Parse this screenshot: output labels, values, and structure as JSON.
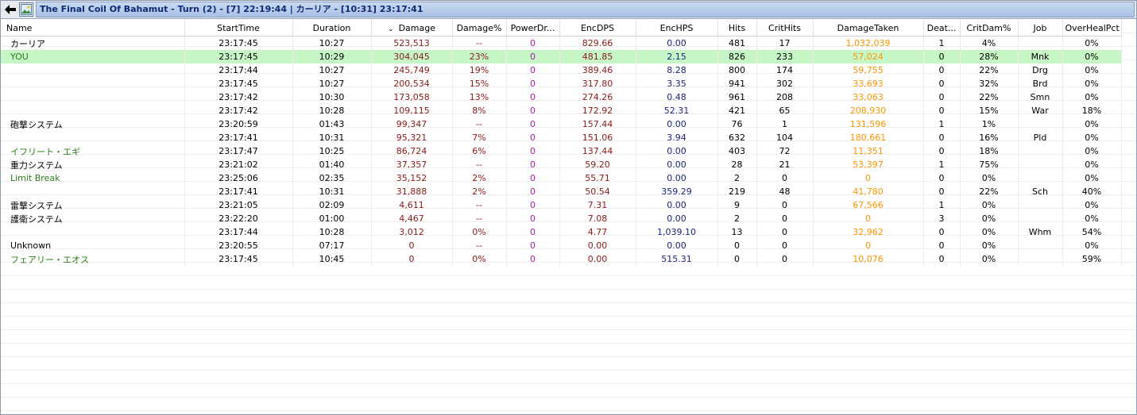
{
  "window": {
    "title": "The Final Coil Of Bahamut - Turn (2) - [7] 22:19:44  |  カーリア - [10:31] 23:17:41",
    "back_icon": "back-arrow-icon",
    "app_icon": "picture-icon"
  },
  "columns": [
    "Name",
    "StartTime",
    "Duration",
    "Damage",
    "Damage%",
    "PowerDr...",
    "EncDPS",
    "EncHPS",
    "Hits",
    "CritHits",
    "DamageTaken",
    "Deat...",
    "CritDam%",
    "Job",
    "OverHealPct"
  ],
  "sort": {
    "column": "Damage",
    "arrow": "⌄"
  },
  "colors": {
    "damage": "#8b1a1a",
    "power": "#a020a0",
    "enchps": "#1a237e",
    "taken": "#ff9500",
    "pet_name": "#2e7d1a",
    "selected_row": "#c6f6c6"
  },
  "rows": [
    {
      "name": "カーリア",
      "start": "23:17:45",
      "duration": "10:27",
      "damage": "523,513",
      "damage_pct": "--",
      "power": "0",
      "encdps": "829.66",
      "enchps": "0.00",
      "hits": "481",
      "crits": "17",
      "taken": "1,032,039",
      "deaths": "1",
      "critdam": "4%",
      "job": "",
      "overheal": "0%",
      "green": false,
      "selected": false
    },
    {
      "name": "YOU",
      "start": "23:17:45",
      "duration": "10:29",
      "damage": "304,045",
      "damage_pct": "23%",
      "power": "0",
      "encdps": "481.85",
      "enchps": "2.15",
      "hits": "826",
      "crits": "233",
      "taken": "57,024",
      "deaths": "0",
      "critdam": "28%",
      "job": "Mnk",
      "overheal": "0%",
      "green": true,
      "selected": true
    },
    {
      "name": "",
      "start": "23:17:44",
      "duration": "10:27",
      "damage": "245,749",
      "damage_pct": "19%",
      "power": "0",
      "encdps": "389.46",
      "enchps": "8.28",
      "hits": "800",
      "crits": "174",
      "taken": "59,755",
      "deaths": "0",
      "critdam": "22%",
      "job": "Drg",
      "overheal": "0%",
      "green": false,
      "selected": false
    },
    {
      "name": "",
      "start": "23:17:45",
      "duration": "10:27",
      "damage": "200,534",
      "damage_pct": "15%",
      "power": "0",
      "encdps": "317.80",
      "enchps": "3.35",
      "hits": "941",
      "crits": "302",
      "taken": "33,693",
      "deaths": "0",
      "critdam": "32%",
      "job": "Brd",
      "overheal": "0%",
      "green": false,
      "selected": false
    },
    {
      "name": "",
      "start": "23:17:42",
      "duration": "10:30",
      "damage": "173,058",
      "damage_pct": "13%",
      "power": "0",
      "encdps": "274.26",
      "enchps": "0.48",
      "hits": "961",
      "crits": "208",
      "taken": "33,063",
      "deaths": "0",
      "critdam": "22%",
      "job": "Smn",
      "overheal": "0%",
      "green": false,
      "selected": false
    },
    {
      "name": "",
      "start": "23:17:42",
      "duration": "10:28",
      "damage": "109,115",
      "damage_pct": "8%",
      "power": "0",
      "encdps": "172.92",
      "enchps": "52.31",
      "hits": "421",
      "crits": "65",
      "taken": "208,930",
      "deaths": "0",
      "critdam": "15%",
      "job": "War",
      "overheal": "18%",
      "green": false,
      "selected": false
    },
    {
      "name": "砲撃システム",
      "start": "23:20:59",
      "duration": "01:43",
      "damage": "99,347",
      "damage_pct": "--",
      "power": "0",
      "encdps": "157.44",
      "enchps": "0.00",
      "hits": "76",
      "crits": "1",
      "taken": "131,596",
      "deaths": "1",
      "critdam": "1%",
      "job": "",
      "overheal": "0%",
      "green": false,
      "selected": false
    },
    {
      "name": "",
      "start": "23:17:41",
      "duration": "10:31",
      "damage": "95,321",
      "damage_pct": "7%",
      "power": "0",
      "encdps": "151.06",
      "enchps": "3.94",
      "hits": "632",
      "crits": "104",
      "taken": "180,661",
      "deaths": "0",
      "critdam": "16%",
      "job": "Pld",
      "overheal": "0%",
      "green": false,
      "selected": false
    },
    {
      "name": "イフリート・エギ",
      "start": "23:17:47",
      "duration": "10:25",
      "damage": "86,724",
      "damage_pct": "6%",
      "power": "0",
      "encdps": "137.44",
      "enchps": "0.00",
      "hits": "403",
      "crits": "72",
      "taken": "11,351",
      "deaths": "0",
      "critdam": "18%",
      "job": "",
      "overheal": "0%",
      "green": true,
      "selected": false
    },
    {
      "name": "重力システム",
      "start": "23:21:02",
      "duration": "01:40",
      "damage": "37,357",
      "damage_pct": "--",
      "power": "0",
      "encdps": "59.20",
      "enchps": "0.00",
      "hits": "28",
      "crits": "21",
      "taken": "53,397",
      "deaths": "1",
      "critdam": "75%",
      "job": "",
      "overheal": "0%",
      "green": false,
      "selected": false
    },
    {
      "name": "Limit Break",
      "start": "23:25:06",
      "duration": "02:35",
      "damage": "35,152",
      "damage_pct": "2%",
      "power": "0",
      "encdps": "55.71",
      "enchps": "0.00",
      "hits": "2",
      "crits": "0",
      "taken": "0",
      "deaths": "0",
      "critdam": "0%",
      "job": "",
      "overheal": "0%",
      "green": true,
      "selected": false
    },
    {
      "name": "",
      "start": "23:17:41",
      "duration": "10:31",
      "damage": "31,888",
      "damage_pct": "2%",
      "power": "0",
      "encdps": "50.54",
      "enchps": "359.29",
      "hits": "219",
      "crits": "48",
      "taken": "41,780",
      "deaths": "0",
      "critdam": "22%",
      "job": "Sch",
      "overheal": "40%",
      "green": false,
      "selected": false
    },
    {
      "name": "雷撃システム",
      "start": "23:21:05",
      "duration": "02:09",
      "damage": "4,611",
      "damage_pct": "--",
      "power": "0",
      "encdps": "7.31",
      "enchps": "0.00",
      "hits": "9",
      "crits": "0",
      "taken": "67,566",
      "deaths": "1",
      "critdam": "0%",
      "job": "",
      "overheal": "0%",
      "green": false,
      "selected": false
    },
    {
      "name": "護衛システム",
      "start": "23:22:20",
      "duration": "01:00",
      "damage": "4,467",
      "damage_pct": "--",
      "power": "0",
      "encdps": "7.08",
      "enchps": "0.00",
      "hits": "2",
      "crits": "0",
      "taken": "0",
      "deaths": "3",
      "critdam": "0%",
      "job": "",
      "overheal": "0%",
      "green": false,
      "selected": false
    },
    {
      "name": "",
      "start": "23:17:44",
      "duration": "10:28",
      "damage": "3,012",
      "damage_pct": "0%",
      "power": "0",
      "encdps": "4.77",
      "enchps": "1,039.10",
      "hits": "13",
      "crits": "0",
      "taken": "32,962",
      "deaths": "0",
      "critdam": "0%",
      "job": "Whm",
      "overheal": "54%",
      "green": false,
      "selected": false
    },
    {
      "name": "Unknown",
      "start": "23:20:55",
      "duration": "07:17",
      "damage": "0",
      "damage_pct": "--",
      "power": "0",
      "encdps": "0.00",
      "enchps": "0.00",
      "hits": "0",
      "crits": "0",
      "taken": "0",
      "deaths": "0",
      "critdam": "0%",
      "job": "",
      "overheal": "0%",
      "green": false,
      "selected": false
    },
    {
      "name": "フェアリー・エオス",
      "start": "23:17:45",
      "duration": "10:45",
      "damage": "0",
      "damage_pct": "0%",
      "power": "0",
      "encdps": "0.00",
      "enchps": "515.31",
      "hits": "0",
      "crits": "0",
      "taken": "10,076",
      "deaths": "0",
      "critdam": "0%",
      "job": "",
      "overheal": "59%",
      "green": true,
      "selected": false
    }
  ]
}
